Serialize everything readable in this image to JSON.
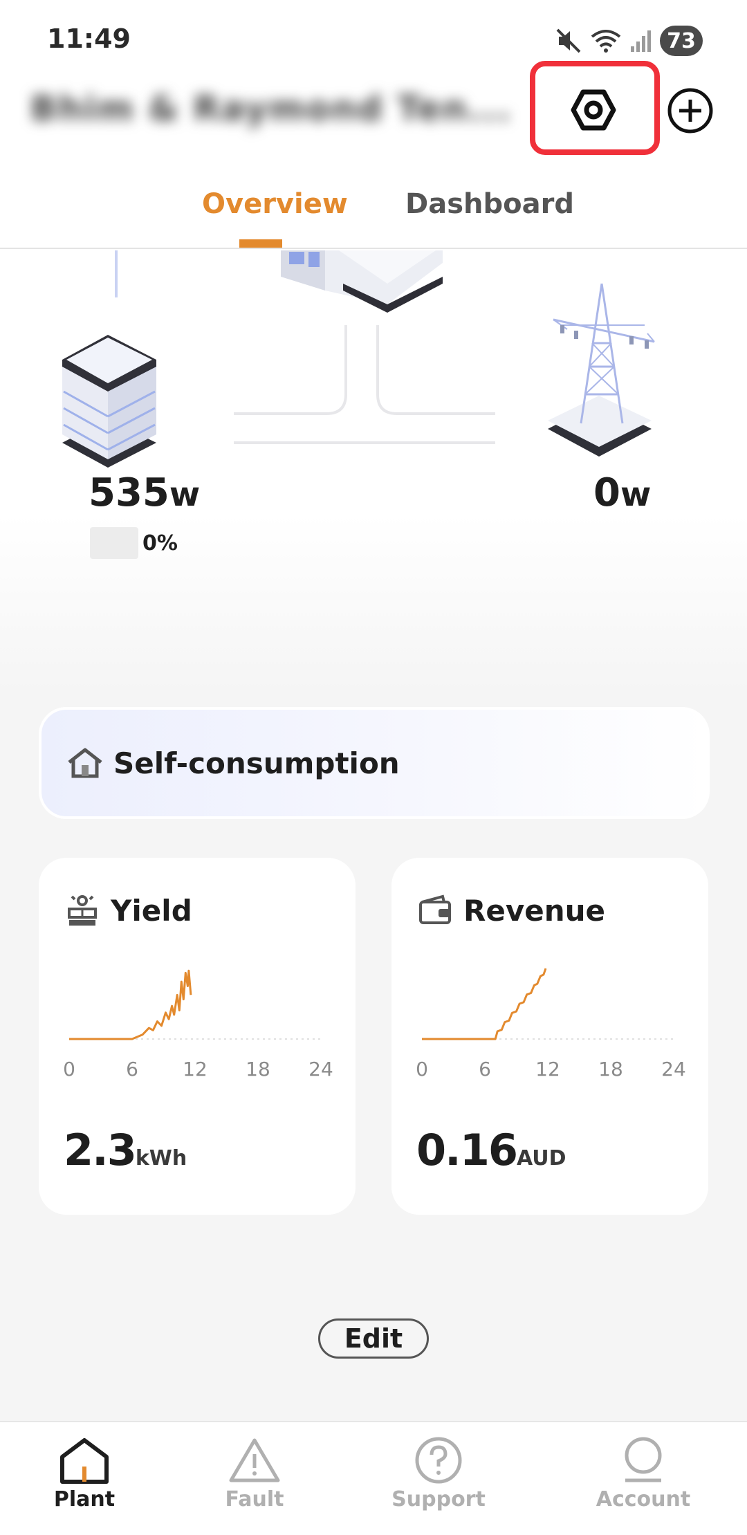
{
  "status_bar": {
    "time": "11:49",
    "battery_level": "73"
  },
  "header": {
    "plant_name": "Bhim & Raymond Ten..."
  },
  "tabs": [
    {
      "label": "Overview",
      "active": true
    },
    {
      "label": "Dashboard",
      "active": false
    }
  ],
  "energy_flow": {
    "battery_power": "535",
    "battery_unit": "w",
    "battery_soc": "0%",
    "grid_power": "0",
    "grid_unit": "w"
  },
  "self_consumption": {
    "label": "Self-consumption"
  },
  "cards": {
    "yield": {
      "title": "Yield",
      "value": "2.3",
      "unit": "kWh",
      "x_ticks": [
        "0",
        "6",
        "12",
        "18",
        "24"
      ],
      "series": [
        [
          0,
          0
        ],
        [
          6,
          0
        ],
        [
          7,
          0.2
        ],
        [
          7.6,
          0.5
        ],
        [
          8,
          0.4
        ],
        [
          8.4,
          0.8
        ],
        [
          8.8,
          0.6
        ],
        [
          9.2,
          1.2
        ],
        [
          9.5,
          0.9
        ],
        [
          9.8,
          1.5
        ],
        [
          10,
          1.1
        ],
        [
          10.3,
          2.0
        ],
        [
          10.5,
          1.3
        ],
        [
          10.7,
          2.6
        ],
        [
          10.9,
          1.8
        ],
        [
          11.1,
          3.0
        ],
        [
          11.3,
          2.4
        ],
        [
          11.4,
          3.1
        ],
        [
          11.6,
          2.0
        ]
      ]
    },
    "revenue": {
      "title": "Revenue",
      "value": "0.16",
      "unit": "AUD",
      "x_ticks": [
        "0",
        "6",
        "12",
        "18",
        "24"
      ],
      "series": [
        [
          0,
          0
        ],
        [
          6.5,
          0
        ],
        [
          7,
          0
        ],
        [
          7.2,
          0.25
        ],
        [
          7.6,
          0.3
        ],
        [
          7.9,
          0.55
        ],
        [
          8.3,
          0.6
        ],
        [
          8.6,
          0.85
        ],
        [
          9,
          0.9
        ],
        [
          9.3,
          1.15
        ],
        [
          9.7,
          1.2
        ],
        [
          10,
          1.45
        ],
        [
          10.4,
          1.5
        ],
        [
          10.7,
          1.75
        ],
        [
          11,
          1.8
        ],
        [
          11.3,
          2.05
        ],
        [
          11.6,
          2.1
        ],
        [
          11.8,
          2.3
        ]
      ]
    }
  },
  "actions": {
    "edit_label": "Edit"
  },
  "bottom_nav": [
    {
      "label": "Plant",
      "active": true
    },
    {
      "label": "Fault",
      "active": false
    },
    {
      "label": "Support",
      "active": false
    },
    {
      "label": "Account",
      "active": false
    }
  ],
  "colors": {
    "accent": "#e38a2e",
    "highlight": "#f0303a",
    "chart_line": "#e38a2e"
  }
}
